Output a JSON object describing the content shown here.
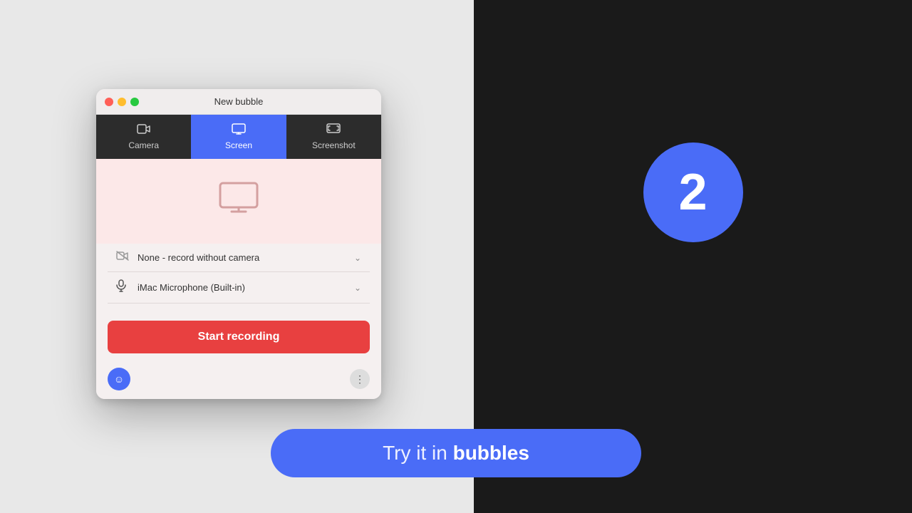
{
  "window": {
    "title": "New bubble",
    "controls": {
      "close": "close",
      "minimize": "minimize",
      "maximize": "maximize"
    }
  },
  "tabs": [
    {
      "id": "camera",
      "label": "Camera",
      "icon": "camera",
      "active": false
    },
    {
      "id": "screen",
      "label": "Screen",
      "icon": "screen",
      "active": true
    },
    {
      "id": "screenshot",
      "label": "Screenshot",
      "icon": "screenshot",
      "active": false
    }
  ],
  "camera_dropdown": {
    "value": "None - record without camera",
    "placeholder": "None - record without camera"
  },
  "microphone_dropdown": {
    "value": "iMac Microphone (Built-in)",
    "placeholder": "iMac Microphone (Built-in)"
  },
  "start_button": {
    "label": "Start recording"
  },
  "right_panel": {
    "number": "2"
  },
  "cta": {
    "text_regular": "Try it in ",
    "text_bold": "bubbles"
  }
}
